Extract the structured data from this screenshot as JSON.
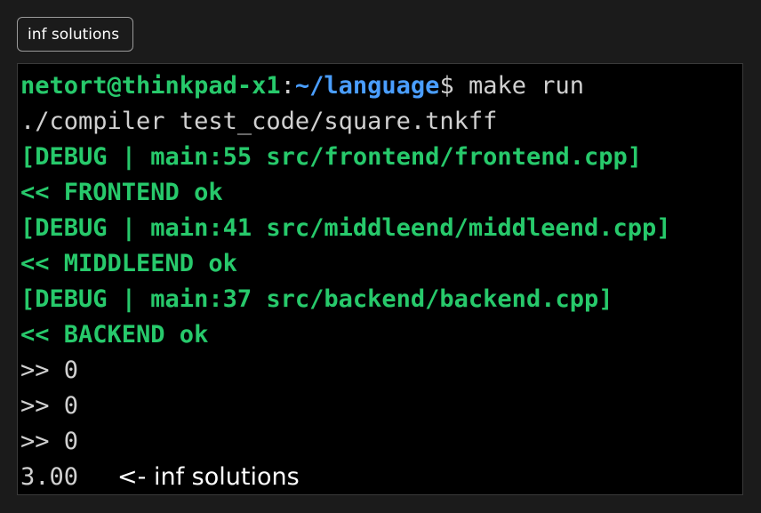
{
  "header": {
    "tag_label": "inf solutions"
  },
  "terminal": {
    "prompt": {
      "user_host": "netort@thinkpad-x1",
      "colon": ":",
      "path": "~/language",
      "dollar": "$",
      "command": " make run"
    },
    "lines": [
      "./compiler test_code/square.tnkff",
      "[DEBUG | main:55 src/frontend/frontend.cpp]",
      "<< FRONTEND ok",
      "[DEBUG | main:41 src/middleend/middleend.cpp]",
      "<< MIDDLEEND ok",
      "[DEBUG | main:37 src/backend/backend.cpp]",
      "<< BACKEND ok",
      ">> 0",
      ">> 0",
      ">> 0"
    ],
    "result_value": "3.00",
    "annotation": "<- inf solutions"
  },
  "colors": {
    "green": "#27c96b",
    "blue": "#4a9eff",
    "gray": "#d0d0d0",
    "background": "#000000"
  }
}
